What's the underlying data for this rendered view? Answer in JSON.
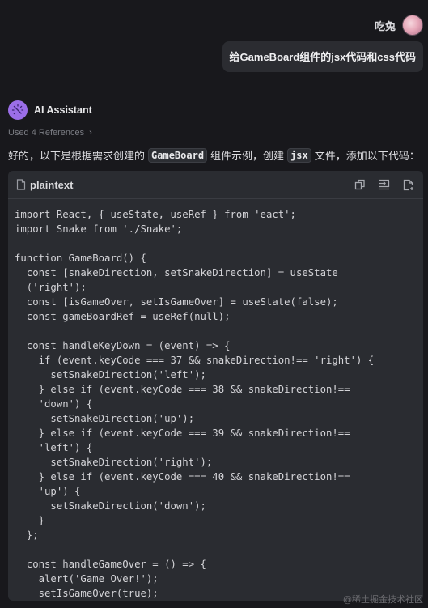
{
  "user": {
    "name": "吃兔",
    "message": "给GameBoard组件的jsx代码和css代码"
  },
  "assistant": {
    "name": "AI Assistant",
    "references_label": "Used 4 References",
    "intro_prefix": "好的，以下是根据需求创建的",
    "intro_chip_1": "GameBoard",
    "intro_middle": "组件示例，创建",
    "intro_chip_2": "jsx",
    "intro_suffix": "文件，添加以下代码："
  },
  "code_block": {
    "language": "plaintext",
    "tools": [
      "copy-icon",
      "insert-icon",
      "new-file-icon"
    ],
    "lines": [
      "import React, { useState, useRef } from 'eact';",
      "import Snake from './Snake';",
      "",
      "function GameBoard() {",
      "  const [snakeDirection, setSnakeDirection] = useState",
      "  ('right');",
      "  const [isGameOver, setIsGameOver] = useState(false);",
      "  const gameBoardRef = useRef(null);",
      "",
      "  const handleKeyDown = (event) => {",
      "    if (event.keyCode === 37 && snakeDirection!== 'right') {",
      "      setSnakeDirection('left');",
      "    } else if (event.keyCode === 38 && snakeDirection!==",
      "    'down') {",
      "      setSnakeDirection('up');",
      "    } else if (event.keyCode === 39 && snakeDirection!==",
      "    'left') {",
      "      setSnakeDirection('right');",
      "    } else if (event.keyCode === 40 && snakeDirection!==",
      "    'up') {",
      "      setSnakeDirection('down');",
      "    }",
      "  };",
      "",
      "  const handleGameOver = () => {",
      "    alert('Game Over!');",
      "    setIsGameOver(true);"
    ]
  },
  "watermark": "@稀土掘金技术社区",
  "colors": {
    "background": "#18181c",
    "panel": "#2a2c31",
    "bubble": "#2b2c31",
    "assistant_avatar": "#9b6ee8"
  }
}
